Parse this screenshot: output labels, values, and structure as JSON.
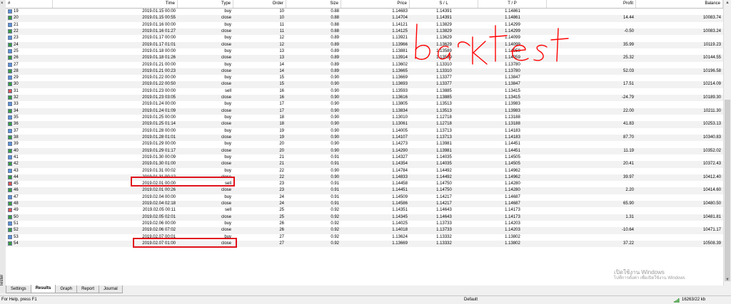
{
  "columns": [
    "#",
    "Time",
    "Type",
    "Order",
    "Size",
    "Price",
    "S / L",
    "T / P",
    "Profit",
    "Balance"
  ],
  "rows": [
    {
      "n": "19",
      "time": "2019.01.15 00:00",
      "type": "buy",
      "order": "10",
      "size": "0.88",
      "price": "1.14683",
      "sl": "1.14391",
      "tp": "1.14861",
      "profit": "",
      "balance": ""
    },
    {
      "n": "20",
      "time": "2019.01.15 00:55",
      "type": "close",
      "order": "10",
      "size": "0.88",
      "price": "1.14704",
      "sl": "1.14391",
      "tp": "1.14861",
      "profit": "14.44",
      "balance": "10083.74"
    },
    {
      "n": "21",
      "time": "2019.01.16 00:00",
      "type": "buy",
      "order": "11",
      "size": "0.88",
      "price": "1.14121",
      "sl": "1.13829",
      "tp": "1.14299",
      "profit": "",
      "balance": ""
    },
    {
      "n": "22",
      "time": "2019.01.16 01:27",
      "type": "close",
      "order": "11",
      "size": "0.88",
      "price": "1.14125",
      "sl": "1.13829",
      "tp": "1.14299",
      "profit": "-0.50",
      "balance": "10083.24"
    },
    {
      "n": "23",
      "time": "2019.01.17 00:00",
      "type": "buy",
      "order": "12",
      "size": "0.89",
      "price": "1.13921",
      "sl": "1.13629",
      "tp": "1.14099",
      "profit": "",
      "balance": ""
    },
    {
      "n": "24",
      "time": "2019.01.17 01:01",
      "type": "close",
      "order": "12",
      "size": "0.89",
      "price": "1.13966",
      "sl": "1.13629",
      "tp": "1.14099",
      "profit": "35.99",
      "balance": "10119.23"
    },
    {
      "n": "25",
      "time": "2019.01.18 00:00",
      "type": "buy",
      "order": "13",
      "size": "0.89",
      "price": "1.13881",
      "sl": "1.13589",
      "tp": "1.14059",
      "profit": "",
      "balance": ""
    },
    {
      "n": "26",
      "time": "2019.01.18 01:26",
      "type": "close",
      "order": "13",
      "size": "0.89",
      "price": "1.13914",
      "sl": "1.13589",
      "tp": "1.14059",
      "profit": "25.32",
      "balance": "10144.55"
    },
    {
      "n": "27",
      "time": "2019.01.21 00:00",
      "type": "buy",
      "order": "14",
      "size": "0.89",
      "price": "1.13602",
      "sl": "1.13310",
      "tp": "1.13780",
      "profit": "",
      "balance": ""
    },
    {
      "n": "28",
      "time": "2019.01.21 00:23",
      "type": "close",
      "order": "14",
      "size": "0.89",
      "price": "1.13665",
      "sl": "1.13310",
      "tp": "1.13780",
      "profit": "52.03",
      "balance": "10196.58"
    },
    {
      "n": "29",
      "time": "2019.01.22 00:00",
      "type": "buy",
      "order": "15",
      "size": "0.90",
      "price": "1.13669",
      "sl": "1.13377",
      "tp": "1.13847",
      "profit": "",
      "balance": ""
    },
    {
      "n": "30",
      "time": "2019.01.22 00:50",
      "type": "close",
      "order": "15",
      "size": "0.90",
      "price": "1.13693",
      "sl": "1.13377",
      "tp": "1.13847",
      "profit": "17.51",
      "balance": "10214.09"
    },
    {
      "n": "31",
      "time": "2019.01.23 00:00",
      "type": "sell",
      "order": "16",
      "size": "0.90",
      "price": "1.13593",
      "sl": "1.13885",
      "tp": "1.13415",
      "profit": "",
      "balance": ""
    },
    {
      "n": "32",
      "time": "2019.01.23 03:05",
      "type": "close",
      "order": "16",
      "size": "0.90",
      "price": "1.13616",
      "sl": "1.13885",
      "tp": "1.13415",
      "profit": "-24.79",
      "balance": "10189.30"
    },
    {
      "n": "33",
      "time": "2019.01.24 00:00",
      "type": "buy",
      "order": "17",
      "size": "0.90",
      "price": "1.13805",
      "sl": "1.13513",
      "tp": "1.13983",
      "profit": "",
      "balance": ""
    },
    {
      "n": "34",
      "time": "2019.01.24 01:09",
      "type": "close",
      "order": "17",
      "size": "0.90",
      "price": "1.13834",
      "sl": "1.13513",
      "tp": "1.13983",
      "profit": "22.00",
      "balance": "10211.30"
    },
    {
      "n": "35",
      "time": "2019.01.25 00:00",
      "type": "buy",
      "order": "18",
      "size": "0.90",
      "price": "1.13010",
      "sl": "1.12718",
      "tp": "1.13188",
      "profit": "",
      "balance": ""
    },
    {
      "n": "36",
      "time": "2019.01.25 01:14",
      "type": "close",
      "order": "18",
      "size": "0.90",
      "price": "1.13061",
      "sl": "1.12718",
      "tp": "1.13188",
      "profit": "41.83",
      "balance": "10253.13"
    },
    {
      "n": "37",
      "time": "2019.01.28 00:00",
      "type": "buy",
      "order": "19",
      "size": "0.90",
      "price": "1.14005",
      "sl": "1.13713",
      "tp": "1.14183",
      "profit": "",
      "balance": ""
    },
    {
      "n": "38",
      "time": "2019.01.28 01:01",
      "type": "close",
      "order": "19",
      "size": "0.90",
      "price": "1.14107",
      "sl": "1.13713",
      "tp": "1.14183",
      "profit": "87.70",
      "balance": "10340.83"
    },
    {
      "n": "39",
      "time": "2019.01.29 00:00",
      "type": "buy",
      "order": "20",
      "size": "0.90",
      "price": "1.14273",
      "sl": "1.13981",
      "tp": "1.14451",
      "profit": "",
      "balance": ""
    },
    {
      "n": "40",
      "time": "2019.01.29 01:17",
      "type": "close",
      "order": "20",
      "size": "0.90",
      "price": "1.14290",
      "sl": "1.13981",
      "tp": "1.14451",
      "profit": "11.19",
      "balance": "10352.02"
    },
    {
      "n": "41",
      "time": "2019.01.30 00:09",
      "type": "buy",
      "order": "21",
      "size": "0.91",
      "price": "1.14327",
      "sl": "1.14035",
      "tp": "1.14505",
      "profit": "",
      "balance": ""
    },
    {
      "n": "42",
      "time": "2019.01.30 01:00",
      "type": "close",
      "order": "21",
      "size": "0.91",
      "price": "1.14354",
      "sl": "1.14035",
      "tp": "1.14505",
      "profit": "20.41",
      "balance": "10372.43"
    },
    {
      "n": "43",
      "time": "2019.01.31 00:02",
      "type": "buy",
      "order": "22",
      "size": "0.90",
      "price": "1.14784",
      "sl": "1.14492",
      "tp": "1.14962",
      "profit": "",
      "balance": ""
    },
    {
      "n": "44",
      "time": "2019.01.31 00:12",
      "type": "close",
      "order": "22",
      "size": "0.90",
      "price": "1.14833",
      "sl": "1.14492",
      "tp": "1.14962",
      "profit": "39.97",
      "balance": "10412.40"
    },
    {
      "n": "45",
      "time": "2019.02.01 00:00",
      "type": "sell",
      "order": "23",
      "size": "0.91",
      "price": "1.14458",
      "sl": "1.14750",
      "tp": "1.14280",
      "profit": "",
      "balance": ""
    },
    {
      "n": "46",
      "time": "2019.02.01 00:26",
      "type": "close",
      "order": "23",
      "size": "0.91",
      "price": "1.14451",
      "sl": "1.14750",
      "tp": "1.14280",
      "profit": "2.20",
      "balance": "10414.60"
    },
    {
      "n": "47",
      "time": "2019.02.04 00:00",
      "type": "buy",
      "order": "24",
      "size": "0.91",
      "price": "1.14509",
      "sl": "1.14217",
      "tp": "1.14687",
      "profit": "",
      "balance": ""
    },
    {
      "n": "48",
      "time": "2019.02.04 02:18",
      "type": "close",
      "order": "24",
      "size": "0.91",
      "price": "1.14586",
      "sl": "1.14217",
      "tp": "1.14687",
      "profit": "65.90",
      "balance": "10480.50"
    },
    {
      "n": "49",
      "time": "2019.02.05 00:11",
      "type": "sell",
      "order": "25",
      "size": "0.92",
      "price": "1.14351",
      "sl": "1.14643",
      "tp": "1.14173",
      "profit": "",
      "balance": ""
    },
    {
      "n": "50",
      "time": "2019.02.05 02:01",
      "type": "close",
      "order": "25",
      "size": "0.92",
      "price": "1.14345",
      "sl": "1.14643",
      "tp": "1.14173",
      "profit": "1.31",
      "balance": "10481.81"
    },
    {
      "n": "51",
      "time": "2019.02.06 00:00",
      "type": "buy",
      "order": "26",
      "size": "0.92",
      "price": "1.14025",
      "sl": "1.13733",
      "tp": "1.14203",
      "profit": "",
      "balance": ""
    },
    {
      "n": "52",
      "time": "2019.02.06 07:02",
      "type": "close",
      "order": "26",
      "size": "0.92",
      "price": "1.14018",
      "sl": "1.13733",
      "tp": "1.14203",
      "profit": "-10.64",
      "balance": "10471.17"
    },
    {
      "n": "53",
      "time": "2019.02.07 00:01",
      "type": "buy",
      "order": "27",
      "size": "0.92",
      "price": "1.13624",
      "sl": "1.13332",
      "tp": "1.13802",
      "profit": "",
      "balance": ""
    },
    {
      "n": "54",
      "time": "2019.02.07 01:00",
      "type": "close",
      "order": "27",
      "size": "0.92",
      "price": "1.13669",
      "sl": "1.13332",
      "tp": "1.13802",
      "profit": "37.22",
      "balance": "10508.39"
    }
  ],
  "tabs": [
    "Settings",
    "Results",
    "Graph",
    "Report",
    "Journal"
  ],
  "active_tab": "Results",
  "tester_label": "Tester",
  "tester_close": "×",
  "annotation": "backtest",
  "status": {
    "help": "For Help, press F1",
    "profile": "Default",
    "traffic": "16263/22 kb"
  },
  "watermark": {
    "line1": "เปิดใช้งาน Windows",
    "line2": "ไปที่การตั้งค่า เพื่อเปิดใช้งาน Windows"
  },
  "colors": {
    "highlight_box": "#e0121b",
    "annotation_ink": "#ff0000"
  }
}
